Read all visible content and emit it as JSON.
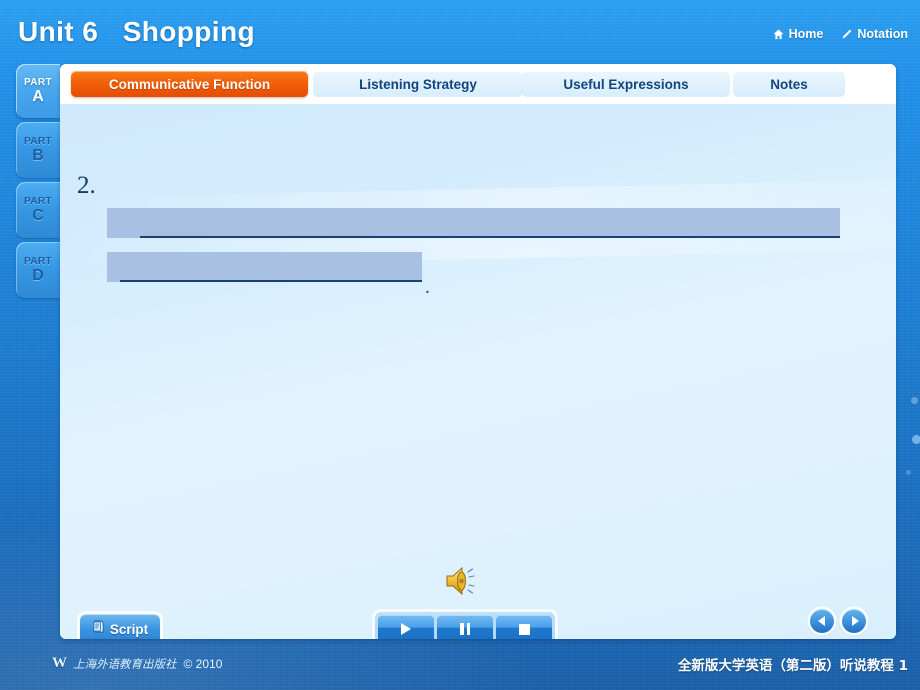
{
  "header": {
    "title": "Unit 6   Shopping",
    "links": [
      {
        "label": "Home",
        "icon": "home-icon"
      },
      {
        "label": "Notation",
        "icon": "pencil-icon"
      }
    ]
  },
  "sidebar": {
    "items": [
      {
        "kicker": "PART",
        "letter": "A",
        "active": true
      },
      {
        "kicker": "PART",
        "letter": "B",
        "active": false
      },
      {
        "kicker": "PART",
        "letter": "C",
        "active": false
      },
      {
        "kicker": "PART",
        "letter": "D",
        "active": false
      }
    ]
  },
  "tabs": [
    {
      "label": "Communicative Function",
      "active": true
    },
    {
      "label": "Listening Strategy",
      "active": false
    },
    {
      "label": "Useful Expressions",
      "active": false
    },
    {
      "label": "Notes",
      "active": false
    }
  ],
  "content": {
    "question_number": "2.",
    "blanks": [
      {
        "value": "",
        "selected": true
      },
      {
        "value": "",
        "selected": true
      }
    ],
    "trailing_punctuation": ".",
    "audio_icon": "speaker-icon"
  },
  "controls": {
    "script_button": {
      "label": "Script",
      "icon": "script-icon"
    },
    "transport": [
      {
        "name": "play",
        "icon": "play-icon"
      },
      {
        "name": "pause",
        "icon": "pause-icon"
      },
      {
        "name": "stop",
        "icon": "stop-icon"
      }
    ],
    "navigation": [
      {
        "name": "previous",
        "icon": "arrow-left-icon"
      },
      {
        "name": "next",
        "icon": "arrow-right-icon"
      }
    ]
  },
  "footer": {
    "publisher_mark": "W",
    "publisher_cn": "上海外语教育出版社",
    "copyright": "© 2010",
    "book_title": "全新版大学英语（第二版）听说教程 1"
  },
  "colors": {
    "background_blue": "#1b7fd4",
    "accent_orange": "#f1600a",
    "panel_blue": "#dff2fe",
    "highlight_blue": "#a8c1e2",
    "rule_navy": "#1d3f73"
  }
}
